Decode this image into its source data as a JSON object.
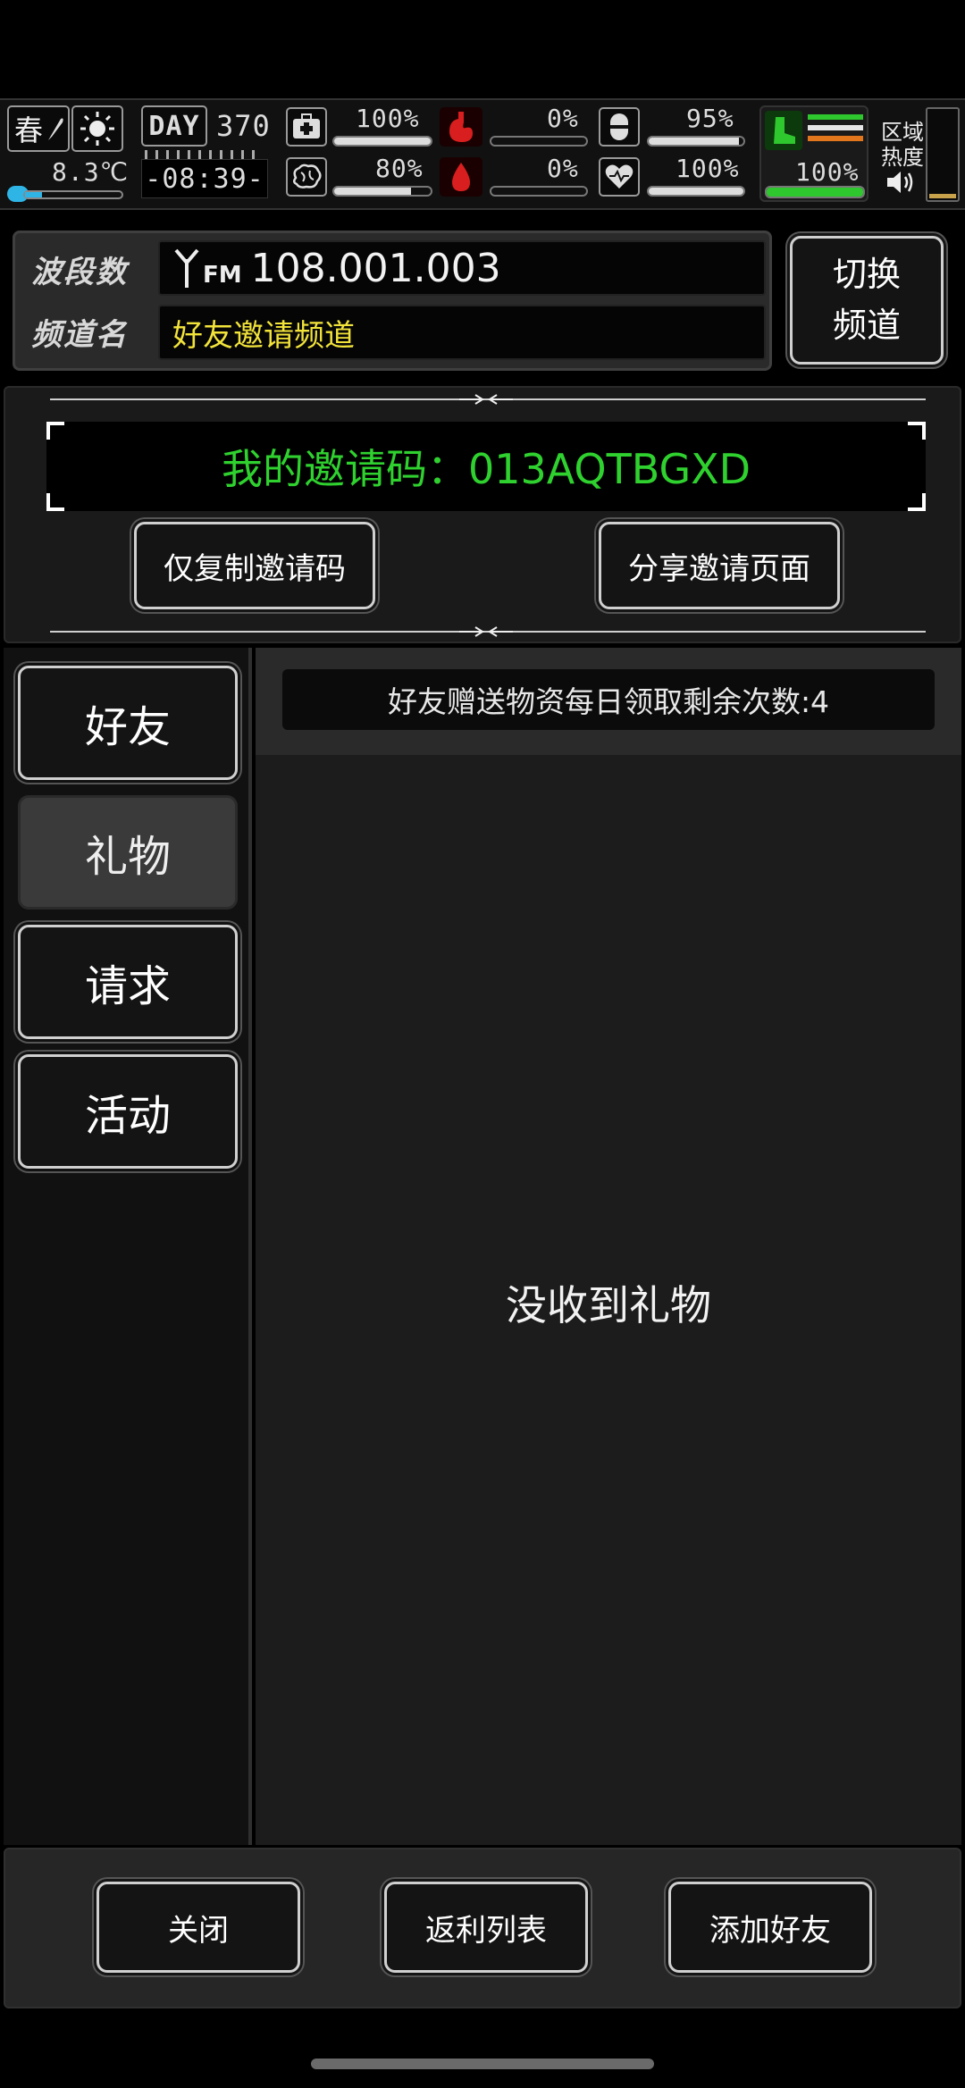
{
  "hud": {
    "season": "春",
    "temperature": "8.3℃",
    "day_label": "DAY",
    "day_number": "370",
    "clock": "-08:39-",
    "stats": [
      {
        "icon": "medkit-icon",
        "value": "100%",
        "level": 1.0
      },
      {
        "icon": "stomach-icon",
        "value": "0%",
        "level": 0.0
      },
      {
        "icon": "sleep-capsule-icon",
        "value": "95%",
        "level": 0.95
      },
      {
        "icon": "brain-icon",
        "value": "80%",
        "level": 0.8
      },
      {
        "icon": "blood-drop-icon",
        "value": "0%",
        "level": 0.0
      },
      {
        "icon": "heart-icon",
        "value": "100%",
        "level": 1.0
      }
    ],
    "stamina_value": "100%",
    "stamina_level": 1.0,
    "zone_heat_label_1": "区域",
    "zone_heat_label_2": "热度"
  },
  "channel": {
    "band_label": "波段数",
    "band_value": "108.001.003",
    "fm_label": "FM",
    "name_label": "频道名",
    "name_value": "好友邀请频道",
    "switch_line1": "切换",
    "switch_line2": "频道"
  },
  "invite": {
    "code_text": "我的邀请码：013AQTBGXD",
    "copy_button": "仅复制邀请码",
    "share_button": "分享邀请页面"
  },
  "tabs": [
    {
      "label": "好友",
      "active": false
    },
    {
      "label": "礼物",
      "active": true
    },
    {
      "label": "请求",
      "active": false
    },
    {
      "label": "活动",
      "active": false
    }
  ],
  "content": {
    "notice": "好友赠送物资每日领取剩余次数:4",
    "empty_text": "没收到礼物"
  },
  "footer": {
    "close": "关闭",
    "rebate": "返利列表",
    "add_friend": "添加好友"
  },
  "colors": {
    "accent_green": "#2fd12f",
    "channel_yellow": "#f2e33a",
    "danger_red": "#d81e1e"
  }
}
